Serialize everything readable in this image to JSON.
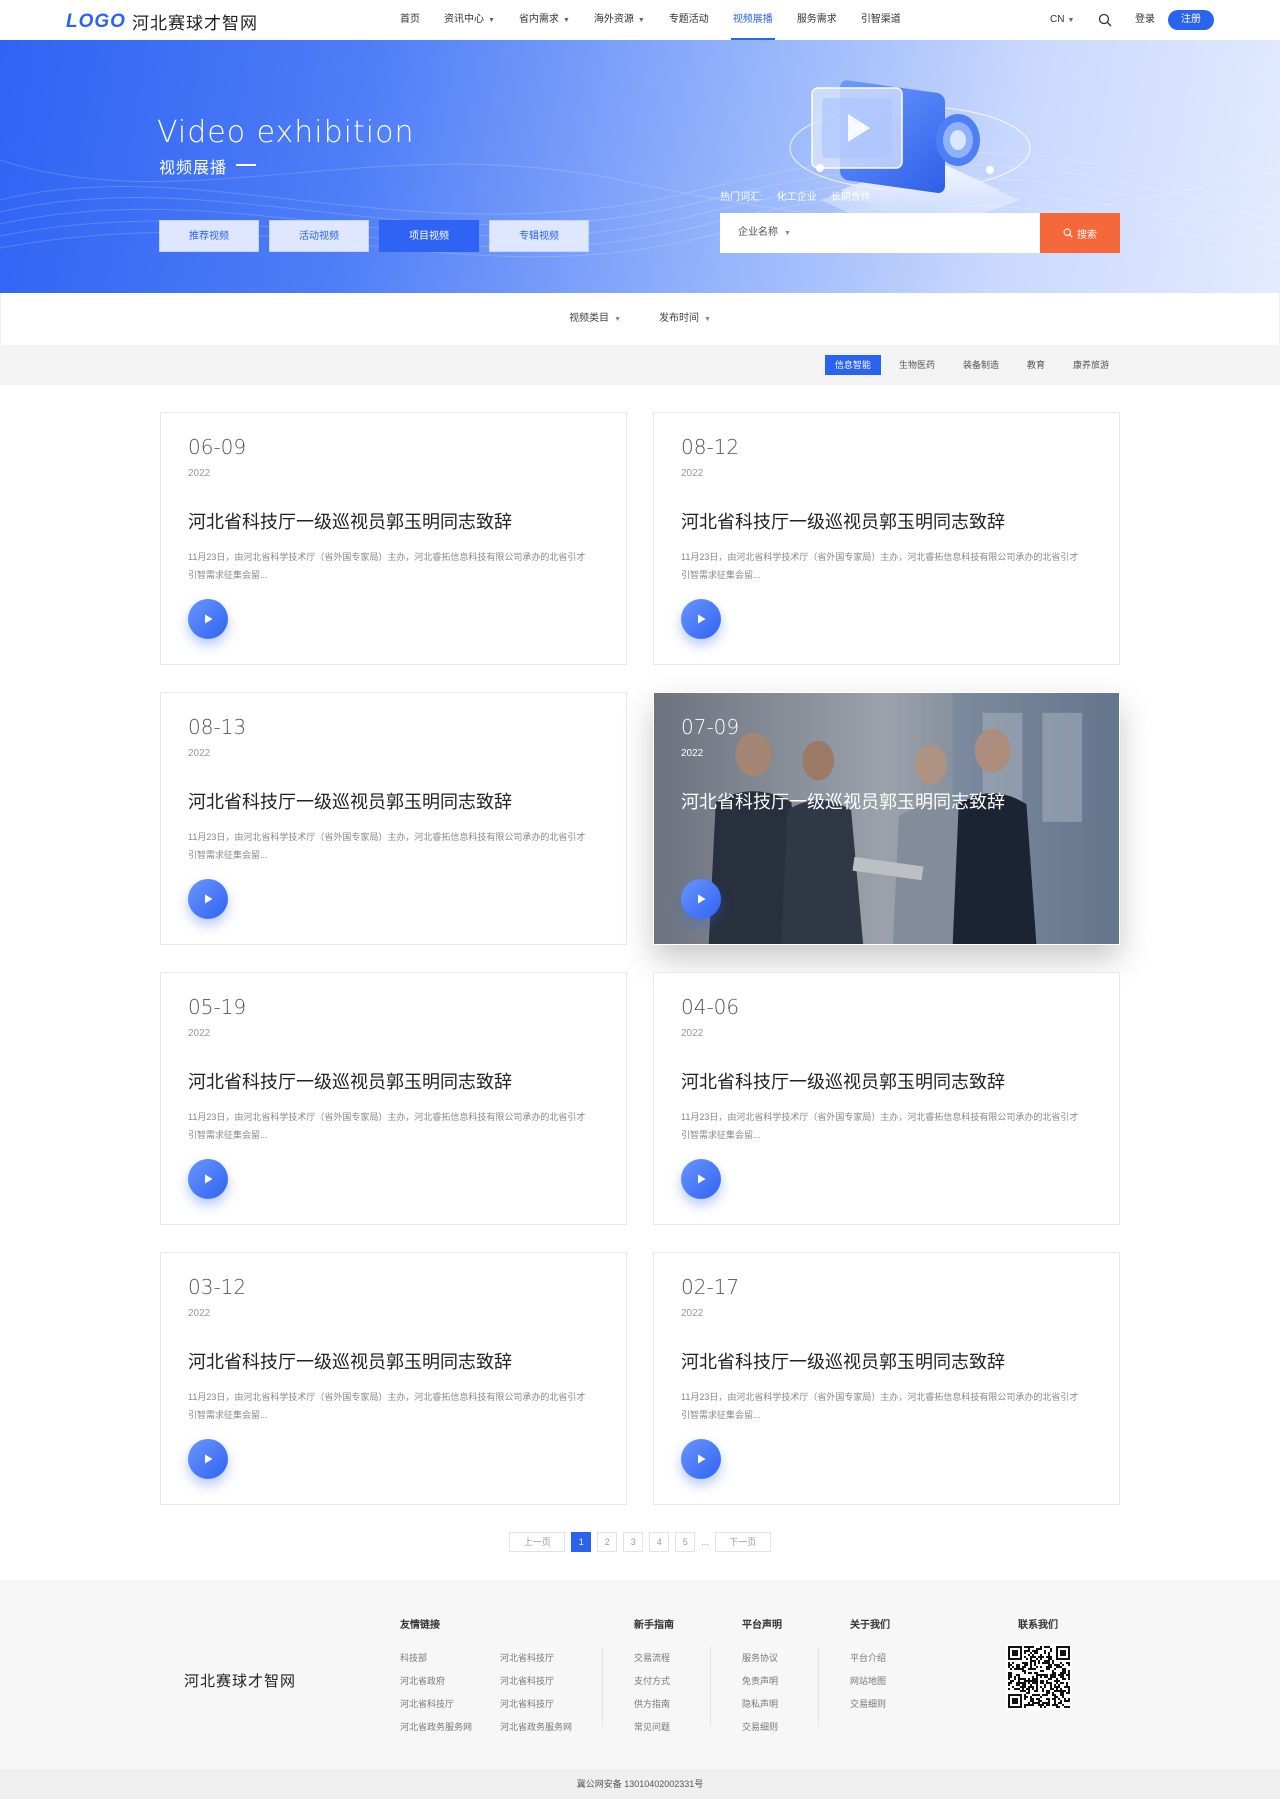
{
  "header": {
    "logo_mark": "LOGO",
    "logo_text": "河北赛球才智网",
    "nav": [
      {
        "label": "首页",
        "caret": false
      },
      {
        "label": "资讯中心",
        "caret": true
      },
      {
        "label": "省内需求",
        "caret": true
      },
      {
        "label": "海外资源",
        "caret": true
      },
      {
        "label": "专题活动",
        "caret": false
      },
      {
        "label": "视频展播",
        "caret": false,
        "active": true
      },
      {
        "label": "服务需求",
        "caret": false
      },
      {
        "label": "引智渠道",
        "caret": false
      }
    ],
    "lang": "CN",
    "login": "登录",
    "register": "注册"
  },
  "banner": {
    "title_en": "Video exhibition",
    "title_cn": "视频展播",
    "tabs": [
      "推荐视频",
      "活动视频",
      "项目视频",
      "专辑视频"
    ],
    "active_tab": 2,
    "hot_label": "热门词汇:",
    "hot_words": [
      "化工企业",
      "长期合作"
    ],
    "search_select": "企业名称",
    "search_button": "搜索"
  },
  "filters": {
    "items": [
      "视频类目",
      "发布时间"
    ],
    "tags": [
      "信息智能",
      "生物医药",
      "装备制造",
      "教育",
      "康养旅游"
    ],
    "active_tag": 0
  },
  "cards": [
    {
      "date": "06-09",
      "year": "2022",
      "title": "河北省科技厅一级巡视员郭玉明同志致辞",
      "desc": "11月23日，由河北省科学技术厅（省外国专家局）主办，河北睿拓信息科技有限公司承办的北省引才引智需求征集会留...",
      "featured": false
    },
    {
      "date": "08-12",
      "year": "2022",
      "title": "河北省科技厅一级巡视员郭玉明同志致辞",
      "desc": "11月23日，由河北省科学技术厅（省外国专家局）主办，河北睿拓信息科技有限公司承办的北省引才引智需求征集会留...",
      "featured": false
    },
    {
      "date": "08-13",
      "year": "2022",
      "title": "河北省科技厅一级巡视员郭玉明同志致辞",
      "desc": "11月23日，由河北省科学技术厅（省外国专家局）主办，河北睿拓信息科技有限公司承办的北省引才引智需求征集会留...",
      "featured": false
    },
    {
      "date": "07-09",
      "year": "2022",
      "title": "河北省科技厅一级巡视员郭玉明同志致辞",
      "desc": "",
      "featured": true
    },
    {
      "date": "05-19",
      "year": "2022",
      "title": "河北省科技厅一级巡视员郭玉明同志致辞",
      "desc": "11月23日，由河北省科学技术厅（省外国专家局）主办，河北睿拓信息科技有限公司承办的北省引才引智需求征集会留...",
      "featured": false
    },
    {
      "date": "04-06",
      "year": "2022",
      "title": "河北省科技厅一级巡视员郭玉明同志致辞",
      "desc": "11月23日，由河北省科学技术厅（省外国专家局）主办，河北睿拓信息科技有限公司承办的北省引才引智需求征集会留...",
      "featured": false
    },
    {
      "date": "03-12",
      "year": "2022",
      "title": "河北省科技厅一级巡视员郭玉明同志致辞",
      "desc": "11月23日，由河北省科学技术厅（省外国专家局）主办，河北睿拓信息科技有限公司承办的北省引才引智需求征集会留...",
      "featured": false
    },
    {
      "date": "02-17",
      "year": "2022",
      "title": "河北省科技厅一级巡视员郭玉明同志致辞",
      "desc": "11月23日，由河北省科学技术厅（省外国专家局）主办，河北睿拓信息科技有限公司承办的北省引才引智需求征集会留...",
      "featured": false
    }
  ],
  "pager": {
    "prev": "上一页",
    "pages": [
      "1",
      "2",
      "3",
      "4",
      "5"
    ],
    "current": "1",
    "ellipsis": "...",
    "next": "下一页"
  },
  "footer": {
    "logo_text": "河北赛球才智网",
    "friend_links": {
      "title": "友情链接",
      "col1": [
        "科技部",
        "河北省政府",
        "河北省科技厅",
        "河北省政务服务网"
      ],
      "col2": [
        "河北省科技厅",
        "河北省科技厅",
        "河北省科技厅",
        "河北省政务服务网"
      ]
    },
    "guide": {
      "title": "新手指南",
      "links": [
        "交易流程",
        "支付方式",
        "供方指南",
        "常见问题"
      ]
    },
    "statement": {
      "title": "平台声明",
      "links": [
        "服务协议",
        "免责声明",
        "隐私声明",
        "交易细则"
      ]
    },
    "about": {
      "title": "关于我们",
      "links": [
        "平台介绍",
        "网站地图",
        "交易细则"
      ]
    },
    "contact_title": "联系我们",
    "copyright": "冀公网安备 13010402002331号"
  },
  "colors": {
    "primary": "#2a63f0",
    "search_orange": "#f4683a",
    "footer_bg": "#f7f7f7"
  },
  "icons": [
    "search-icon",
    "play-icon",
    "chevron-down-icon",
    "qr-code-icon"
  ]
}
